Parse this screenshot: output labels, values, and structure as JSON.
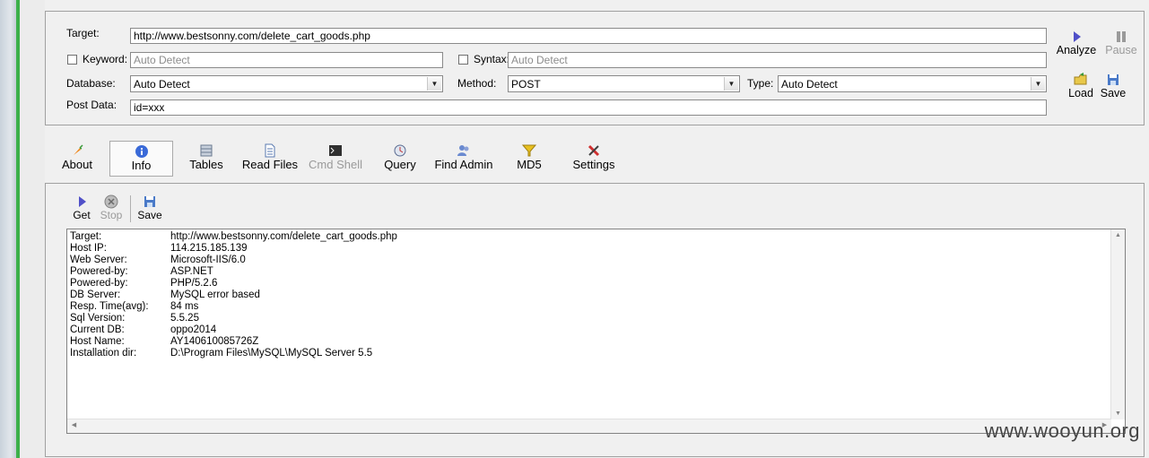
{
  "form": {
    "target_label": "Target:",
    "target_value": "http://www.bestsonny.com/delete_cart_goods.php",
    "keyword_label": "Keyword:",
    "keyword_placeholder": "Auto Detect",
    "syntax_label": "Syntax:",
    "syntax_placeholder": "Auto Detect",
    "database_label": "Database:",
    "database_value": "Auto Detect",
    "method_label": "Method:",
    "method_value": "POST",
    "type_label": "Type:",
    "type_value": "Auto Detect",
    "postdata_label": "Post Data:",
    "postdata_value": "id=xxx"
  },
  "actions": {
    "analyze": "Analyze",
    "pause": "Pause",
    "load": "Load",
    "save": "Save"
  },
  "tabs": [
    {
      "label": "About",
      "icon": "carrot-icon"
    },
    {
      "label": "Info",
      "icon": "info-icon"
    },
    {
      "label": "Tables",
      "icon": "table-icon"
    },
    {
      "label": "Read Files",
      "icon": "file-icon"
    },
    {
      "label": "Cmd Shell",
      "icon": "terminal-icon"
    },
    {
      "label": "Query",
      "icon": "query-icon"
    },
    {
      "label": "Find Admin",
      "icon": "admin-icon"
    },
    {
      "label": "MD5",
      "icon": "funnel-icon"
    },
    {
      "label": "Settings",
      "icon": "tools-icon"
    }
  ],
  "info_toolbar": {
    "get": "Get",
    "stop": "Stop",
    "save": "Save"
  },
  "info": [
    {
      "key": "Target:",
      "value": "http://www.bestsonny.com/delete_cart_goods.php"
    },
    {
      "key": "Host IP:",
      "value": "114.215.185.139"
    },
    {
      "key": "Web Server:",
      "value": "Microsoft-IIS/6.0"
    },
    {
      "key": "Powered-by:",
      "value": "ASP.NET"
    },
    {
      "key": "Powered-by:",
      "value": "PHP/5.2.6"
    },
    {
      "key": "DB Server:",
      "value": "MySQL error based"
    },
    {
      "key": "Resp. Time(avg):",
      "value": "84 ms"
    },
    {
      "key": "Sql Version:",
      "value": "5.5.25"
    },
    {
      "key": "Current DB:",
      "value": "oppo2014"
    },
    {
      "key": "Host Name:",
      "value": "AY140610085726Z"
    },
    {
      "key": "Installation dir:",
      "value": "D:\\Program Files\\MySQL\\MySQL Server 5.5"
    }
  ],
  "watermark": "www.wooyun.org"
}
